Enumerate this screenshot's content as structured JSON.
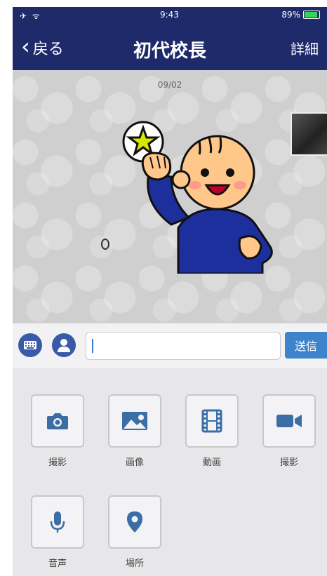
{
  "status_bar": {
    "left": "✈ ᯤ",
    "time": "9:43",
    "battery": "89%",
    "battery_level": 0.89
  },
  "nav": {
    "back_label": "戻る",
    "title": "初代校長",
    "detail_label": "詳細"
  },
  "chat": {
    "date": "09/02"
  },
  "input": {
    "send_label": "送信",
    "value": ""
  },
  "attachments": [
    {
      "label": "撮影",
      "icon": "camera-icon"
    },
    {
      "label": "画像",
      "icon": "image-icon"
    },
    {
      "label": "動画",
      "icon": "film-icon"
    },
    {
      "label": "撮影",
      "icon": "video-camera-icon"
    },
    {
      "label": "音声",
      "icon": "microphone-icon"
    },
    {
      "label": "場所",
      "icon": "location-pin-icon"
    }
  ],
  "colors": {
    "nav": "#1f2a6a",
    "accent": "#3d84cc",
    "icon": "#3a6ea5"
  }
}
